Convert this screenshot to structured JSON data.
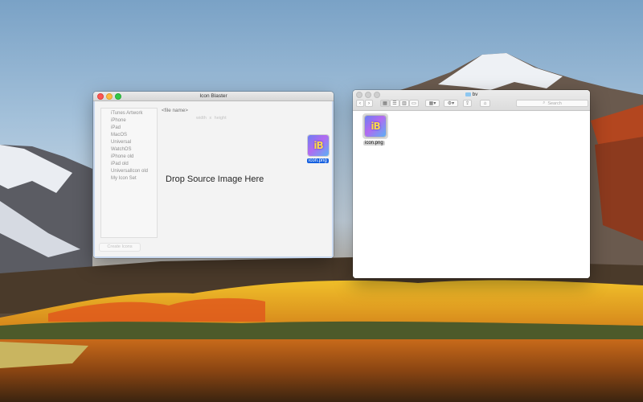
{
  "icon_blaster": {
    "title": "Icon Blaster",
    "targets": [
      "iTunes Artwork",
      "iPhone",
      "iPad",
      "MacOS",
      "Universal",
      "WatchOS",
      "iPhone old",
      "iPad old",
      "UniversalIcon old",
      "My Icon Set"
    ],
    "file_name_placeholder": "<file name>",
    "width_label": "width",
    "times_sign": "x",
    "height_label": "height",
    "drop_prompt": "Drop Source Image Here",
    "create_button": "Create Icons",
    "dropped_icon": {
      "glyph": "iB",
      "label": "icon.png"
    }
  },
  "finder": {
    "title": "bv",
    "toolbar": {
      "back": "‹",
      "forward": "›",
      "view_buttons": [
        "icon-view",
        "list-view",
        "column-view",
        "gallery-view"
      ],
      "group": "group-icon",
      "action": "gear-icon",
      "share": "share-icon",
      "tag": "tag-icon",
      "search_placeholder": "Search"
    },
    "files": [
      {
        "glyph": "iB",
        "label": "icon.png"
      }
    ]
  },
  "colors": {
    "accent": "#1560e0",
    "close": "#fc5753",
    "minimize": "#fdbc40",
    "zoom": "#33c748"
  }
}
